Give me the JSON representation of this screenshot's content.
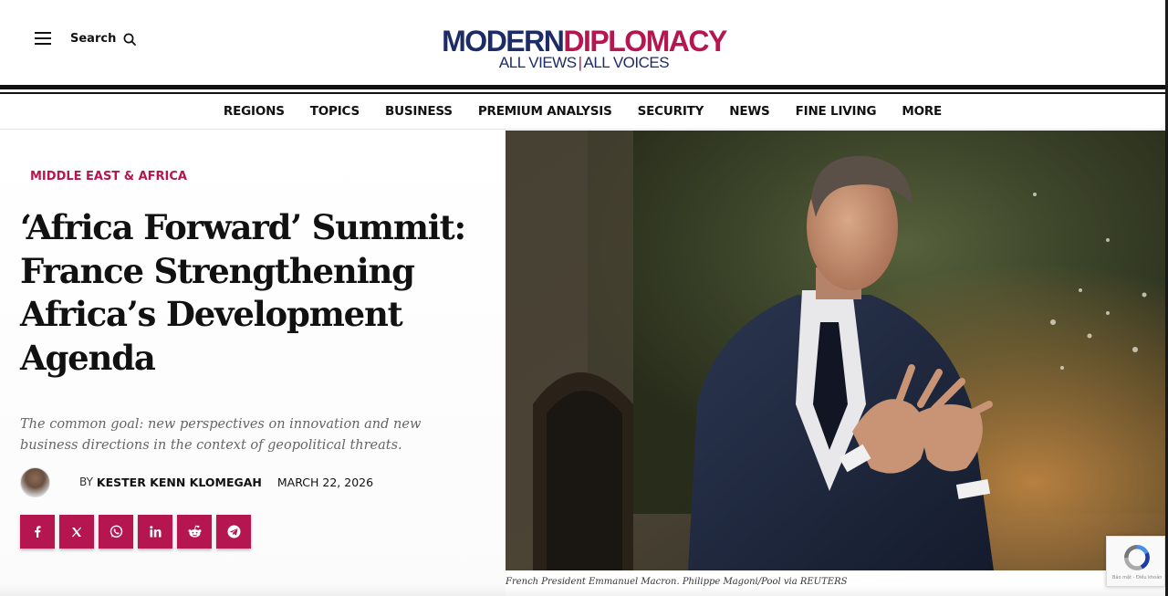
{
  "header": {
    "search_label": "Search",
    "logo": {
      "part1": "MODERN",
      "part2": "DIPLOMACY",
      "tagline_left": "ALL VIEWS",
      "tagline_sep": "|",
      "tagline_right": "ALL VOICES"
    }
  },
  "nav": {
    "items": [
      "REGIONS",
      "TOPICS",
      "BUSINESS",
      "PREMIUM ANALYSIS",
      "SECURITY",
      "NEWS",
      "FINE LIVING",
      "MORE"
    ]
  },
  "article": {
    "category": "MIDDLE EAST & AFRICA",
    "headline": "‘Africa Forward’ Summit: France Strengthening Africa’s Development Agenda",
    "subtitle": "The common goal: new perspectives on innovation and new business directions in the context of geopolitical threats.",
    "by_prefix": "BY",
    "author": "KESTER KENN KLOMEGAH",
    "date": "MARCH 22, 2026",
    "image_caption": "French President Emmanuel Macron. Philippe Magoni/Pool via REUTERS"
  },
  "share": [
    {
      "network": "facebook",
      "icon": "facebook-icon"
    },
    {
      "network": "x",
      "icon": "x-icon"
    },
    {
      "network": "whatsapp",
      "icon": "whatsapp-icon"
    },
    {
      "network": "linkedin",
      "icon": "linkedin-icon"
    },
    {
      "network": "reddit",
      "icon": "reddit-icon"
    },
    {
      "network": "telegram",
      "icon": "telegram-icon"
    }
  ],
  "recaptcha": {
    "text": "Bảo mật - Điều khoản"
  },
  "colors": {
    "brand_navy": "#1d2b66",
    "brand_magenta": "#b5164f",
    "text": "#111111",
    "subtitle": "#666666"
  }
}
